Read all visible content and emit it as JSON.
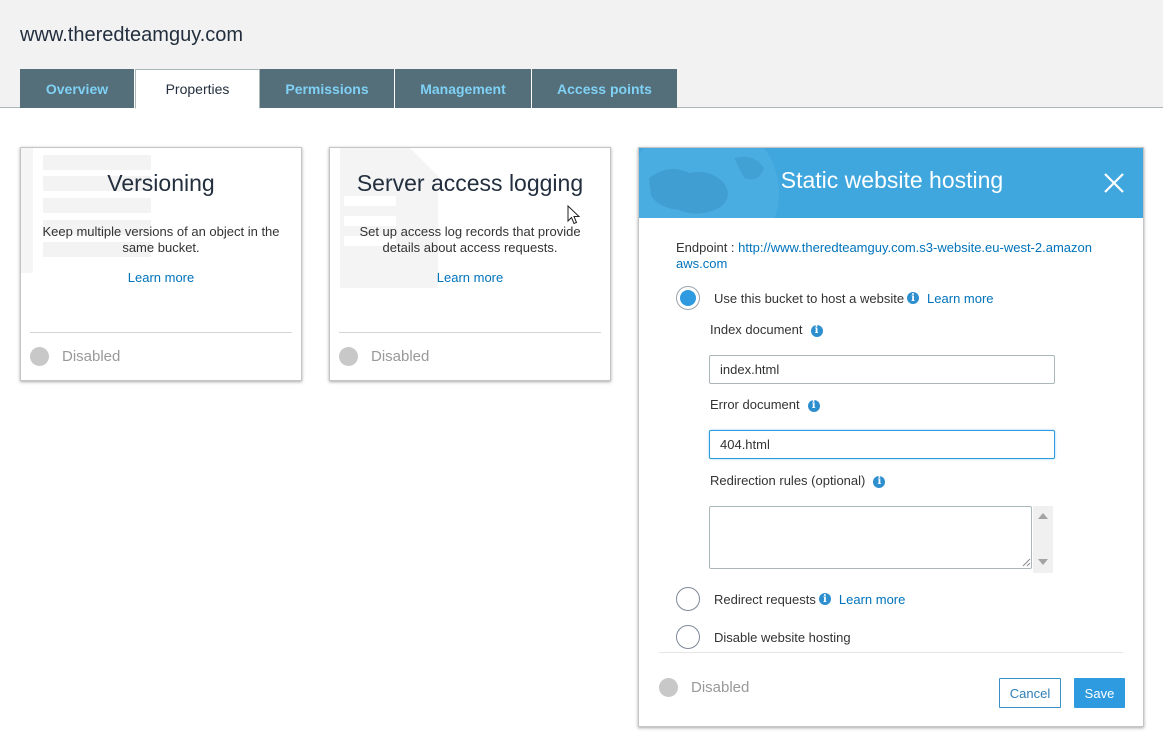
{
  "bucket": {
    "name": "www.theredteamguy.com"
  },
  "tabs": [
    {
      "label": "Overview",
      "active": false
    },
    {
      "label": "Properties",
      "active": true
    },
    {
      "label": "Permissions",
      "active": false
    },
    {
      "label": "Management",
      "active": false
    },
    {
      "label": "Access points",
      "active": false
    }
  ],
  "cards": [
    {
      "title": "Versioning",
      "description": "Keep multiple versions of an object in the same bucket.",
      "learn_more": "Learn more",
      "status": "Disabled"
    },
    {
      "title": "Server access logging",
      "description": "Set up access log records that provide details about access requests.",
      "learn_more": "Learn more",
      "status": "Disabled"
    }
  ],
  "hosting_panel": {
    "title": "Static website hosting",
    "endpoint_label": "Endpoint :",
    "endpoint_url": "http://www.theredteamguy.com.s3-website.eu-west-2.amazonaws.com",
    "options": [
      {
        "label": "Use this bucket to host a website",
        "learn_more": "Learn more",
        "checked": true
      },
      {
        "label": "Redirect requests",
        "learn_more": "Learn more",
        "checked": false
      },
      {
        "label": "Disable website hosting",
        "checked": false
      }
    ],
    "index_document": {
      "label": "Index document",
      "value": "index.html"
    },
    "error_document": {
      "label": "Error document",
      "value": "404.html"
    },
    "redirection_rules": {
      "label": "Redirection rules (optional)",
      "value": ""
    },
    "status": "Disabled",
    "cancel_label": "Cancel",
    "save_label": "Save",
    "info_glyph": "i"
  },
  "colors": {
    "tab_bg": "#546e7a",
    "tab_text": "#7fd1f5",
    "panel_header": "#3fa7dd",
    "primary_button": "#2e9be0",
    "link": "#0073bb"
  }
}
